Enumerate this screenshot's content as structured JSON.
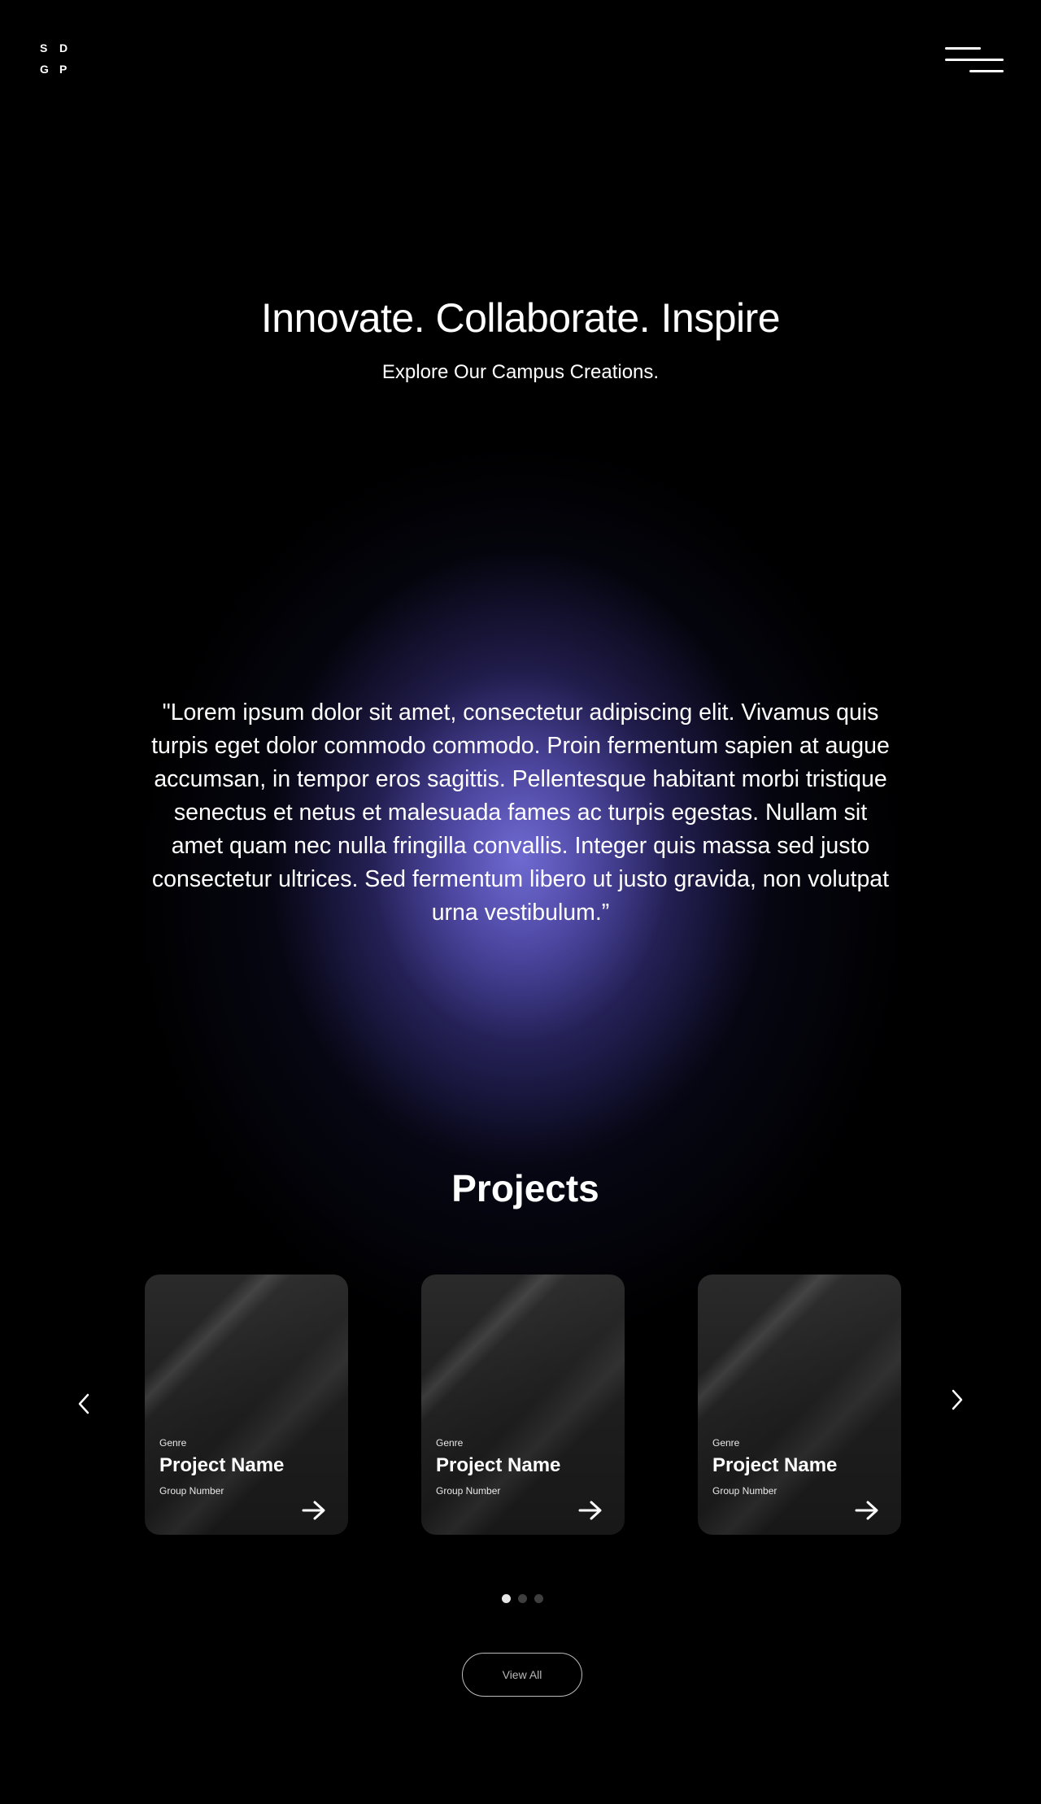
{
  "header": {
    "logo_letters": [
      "S",
      "D",
      "G",
      "P"
    ],
    "menu_icon": "hamburger-menu-icon"
  },
  "hero": {
    "title": "Innovate. Collaborate. Inspire",
    "subtitle": "Explore Our Campus Creations."
  },
  "quote": {
    "text": "\"Lorem ipsum dolor sit amet, consectetur adipiscing elit. Vivamus quis turpis eget dolor commodo commodo. Proin fermentum sapien at augue accumsan, in tempor eros sagittis. Pellentesque habitant morbi tristique senectus et netus et malesuada fames ac turpis egestas. Nullam sit amet quam nec nulla fringilla convallis. Integer quis massa sed justo consectetur ultrices. Sed fermentum libero ut justo gravida, non volutpat urna vestibulum.”"
  },
  "projects": {
    "title": "Projects",
    "cards": [
      {
        "genre": "Genre",
        "name": "Project Name",
        "group": "Group Number",
        "icon": "arrow-right-icon"
      },
      {
        "genre": "Genre",
        "name": "Project Name",
        "group": "Group Number",
        "icon": "arrow-right-icon"
      },
      {
        "genre": "Genre",
        "name": "Project Name",
        "group": "Group Number",
        "icon": "arrow-right-icon"
      }
    ],
    "prev_icon": "chevron-left-icon",
    "next_icon": "chevron-right-icon",
    "pagination": {
      "count": 3,
      "active_index": 0
    },
    "view_all_label": "View All"
  },
  "colors": {
    "background": "#000000",
    "glow_blue": "#4a5ad0",
    "glow_purple": "#7466c8",
    "card_bg": "#1f1f1f",
    "text": "#ffffff"
  }
}
